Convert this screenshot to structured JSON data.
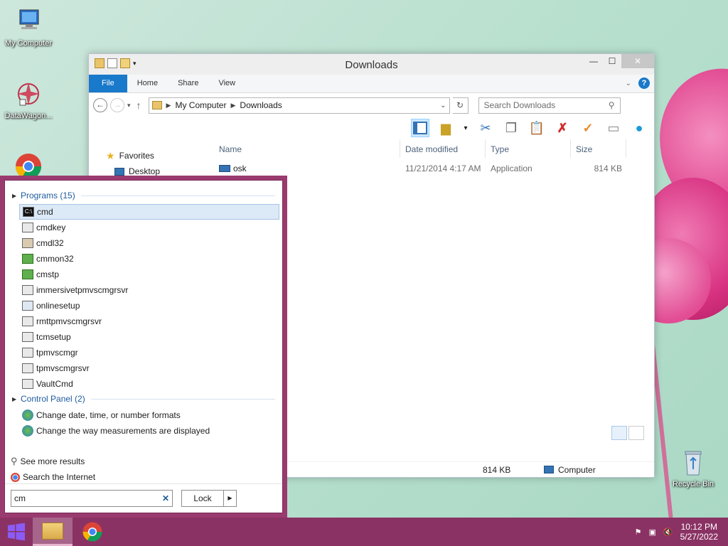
{
  "desktop": {
    "icons": [
      {
        "label": "My Computer"
      },
      {
        "label": "DataWagon..."
      },
      {
        "label": "Recycle Bin"
      }
    ]
  },
  "explorer": {
    "title": "Downloads",
    "tabs": [
      "File",
      "Home",
      "Share",
      "View"
    ],
    "address": [
      "My Computer",
      "Downloads"
    ],
    "search_placeholder": "Search Downloads",
    "nav": [
      {
        "label": "Favorites"
      },
      {
        "label": "Desktop"
      }
    ],
    "columns": [
      "Name",
      "Date modified",
      "Type",
      "Size"
    ],
    "rows": [
      {
        "name": "osk",
        "date": "11/21/2014 4:17 AM",
        "type": "Application",
        "size": "814 KB"
      }
    ],
    "status": {
      "size": "814 KB",
      "location": "Computer"
    }
  },
  "start": {
    "groups": {
      "programs": "Programs (15)",
      "control_panel": "Control Panel (2)"
    },
    "programs": [
      "cmd",
      "cmdkey",
      "cmdl32",
      "cmmon32",
      "cmstp",
      "immersivetpmvscmgrsvr",
      "onlinesetup",
      "rmttpmvscmgrsvr",
      "tcmsetup",
      "tpmvscmgr",
      "tpmvscmgrsvr",
      "VaultCmd"
    ],
    "control_panel": [
      "Change date, time, or number formats",
      "Change the way measurements are displayed"
    ],
    "links": {
      "more": "See more results",
      "internet": "Search the Internet"
    },
    "query": "cm",
    "lock": "Lock"
  },
  "taskbar": {
    "time": "10:12 PM",
    "date": "5/27/2022"
  },
  "colors": {
    "accent": "#1979ca",
    "taskbar": "#8a3264",
    "start_border": "#9a3b6f"
  }
}
